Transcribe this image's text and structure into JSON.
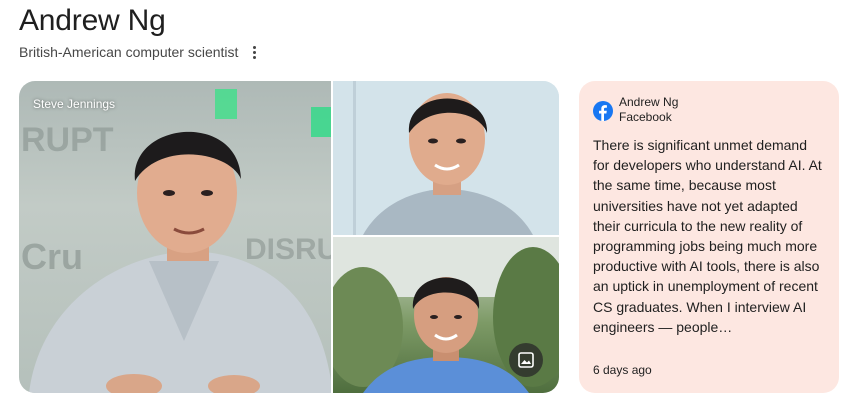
{
  "entity": {
    "name": "Andrew Ng",
    "description": "British-American computer scientist"
  },
  "gallery": {
    "main_photo_credit": "Steve Jennings"
  },
  "post": {
    "author": "Andrew Ng",
    "source": "Facebook",
    "text": "There is significant unmet demand for developers who understand AI. At the same time, because most universities have not yet adapted their curricula to the new reality of programming jobs being much more productive with AI tools, there is also an uptick in unemployment of recent CS graduates. When I interview AI engineers — people…",
    "time": "6 days ago"
  },
  "colors": {
    "card_background": "#fde7e1",
    "facebook_blue": "#1877f2"
  },
  "icons": {
    "more": "more-vert-icon",
    "facebook": "facebook-icon",
    "image": "image-icon"
  }
}
